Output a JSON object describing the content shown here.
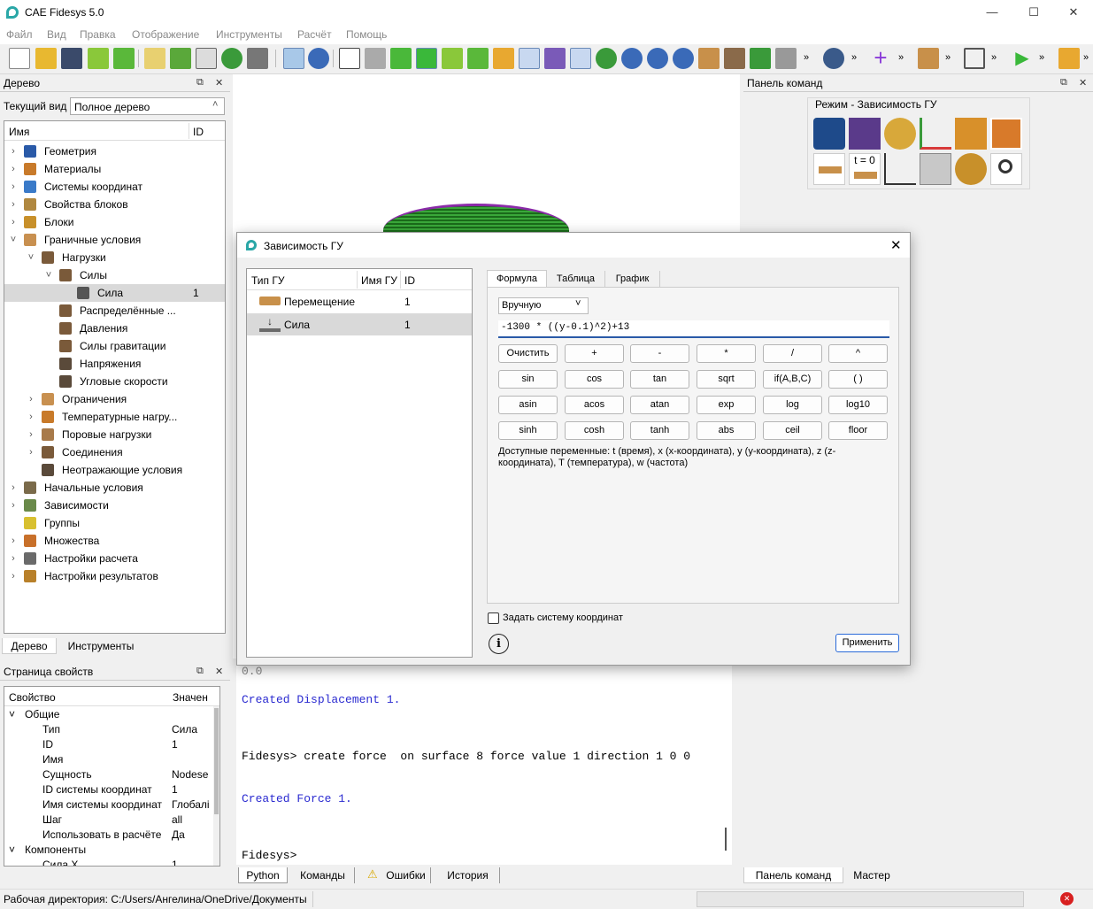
{
  "app": {
    "title": "CAE Fidesys 5.0"
  },
  "menu": [
    "Файл",
    "Вид",
    "Правка",
    "Отображение",
    "Инструменты",
    "Расчёт",
    "Помощь"
  ],
  "tree_panel": {
    "title": "Дерево",
    "view_label": "Текущий вид",
    "view_value": "Полное дерево",
    "col_name": "Имя",
    "col_id": "ID",
    "items": [
      {
        "label": "Геометрия",
        "level": 0,
        "arrow": "›",
        "id": "",
        "color": "#2a5aa8"
      },
      {
        "label": "Материалы",
        "level": 0,
        "arrow": "›",
        "id": "",
        "color": "#c87a2a"
      },
      {
        "label": "Системы координат",
        "level": 0,
        "arrow": "›",
        "id": "",
        "color": "#3a7ac8"
      },
      {
        "label": "Свойства блоков",
        "level": 0,
        "arrow": "›",
        "id": "",
        "color": "#b08840"
      },
      {
        "label": "Блоки",
        "level": 0,
        "arrow": "›",
        "id": "",
        "color": "#c8902a"
      },
      {
        "label": "Граничные условия",
        "level": 0,
        "arrow": "˅",
        "id": "",
        "color": "#c89050"
      },
      {
        "label": "Нагрузки",
        "level": 1,
        "arrow": "˅",
        "id": "",
        "color": "#7a5a3a"
      },
      {
        "label": "Силы",
        "level": 2,
        "arrow": "˅",
        "id": "",
        "color": "#7a5a3a"
      },
      {
        "label": "Сила",
        "level": 3,
        "arrow": "",
        "id": "1",
        "color": "#555555"
      },
      {
        "label": "Распределённые ...",
        "level": 2,
        "arrow": "",
        "id": "",
        "color": "#7a5a3a"
      },
      {
        "label": "Давления",
        "level": 2,
        "arrow": "",
        "id": "",
        "color": "#7a5a3a"
      },
      {
        "label": "Силы гравитации",
        "level": 2,
        "arrow": "",
        "id": "",
        "color": "#7a5a3a"
      },
      {
        "label": "Напряжения",
        "level": 2,
        "arrow": "",
        "id": "",
        "color": "#5a4a3a"
      },
      {
        "label": "Угловые скорости",
        "level": 2,
        "arrow": "",
        "id": "",
        "color": "#5a4a3a"
      },
      {
        "label": "Ограничения",
        "level": 1,
        "arrow": "›",
        "id": "",
        "color": "#c89050"
      },
      {
        "label": "Температурные нагру...",
        "level": 1,
        "arrow": "›",
        "id": "",
        "color": "#c87a2a"
      },
      {
        "label": "Поровые нагрузки",
        "level": 1,
        "arrow": "›",
        "id": "",
        "color": "#a87a4a"
      },
      {
        "label": "Соединения",
        "level": 1,
        "arrow": "›",
        "id": "",
        "color": "#7a5a3a"
      },
      {
        "label": "Неотражающие условия",
        "level": 1,
        "arrow": "",
        "id": "",
        "color": "#5a4a3a"
      },
      {
        "label": "Начальные условия",
        "level": 0,
        "arrow": "›",
        "id": "",
        "color": "#7a6a4a"
      },
      {
        "label": "Зависимости",
        "level": 0,
        "arrow": "›",
        "id": "",
        "color": "#6a8a4a"
      },
      {
        "label": "Группы",
        "level": 0,
        "arrow": "",
        "id": "",
        "color": "#d8c030"
      },
      {
        "label": "Множества",
        "level": 0,
        "arrow": "›",
        "id": "",
        "color": "#c8702a"
      },
      {
        "label": "Настройки расчета",
        "level": 0,
        "arrow": "›",
        "id": "",
        "color": "#6a6a6a"
      },
      {
        "label": "Настройки результатов",
        "level": 0,
        "arrow": "›",
        "id": "",
        "color": "#b8802a"
      }
    ],
    "tabs": [
      "Дерево",
      "Инструменты"
    ]
  },
  "props_panel": {
    "title": "Страница свойств",
    "col_prop": "Свойство",
    "col_val": "Значен",
    "rows": [
      {
        "name": "Общие",
        "value": "",
        "group": true
      },
      {
        "name": "Тип",
        "value": "Сила",
        "group": false
      },
      {
        "name": "ID",
        "value": "1",
        "group": false
      },
      {
        "name": "Имя",
        "value": "",
        "group": false
      },
      {
        "name": "Сущность",
        "value": "Nodese",
        "group": false
      },
      {
        "name": "ID системы координат",
        "value": "1",
        "group": false
      },
      {
        "name": "Имя системы координат",
        "value": "Глобалі",
        "group": false
      },
      {
        "name": "Шаг",
        "value": "all",
        "group": false
      },
      {
        "name": "Использовать в расчёте",
        "value": "Да",
        "group": false
      },
      {
        "name": "Компоненты",
        "value": "",
        "group": true
      },
      {
        "name": "Сила X",
        "value": "1",
        "group": false
      }
    ]
  },
  "console": {
    "lines": [
      {
        "text": "0.0",
        "style": "gray"
      },
      {
        "text": "Created Displacement 1.",
        "style": "blue"
      },
      {
        "text": "Fidesys> create force  on surface 8 force value 1 direction 1 0 0",
        "style": "prompt"
      },
      {
        "text": "Created Force 1.",
        "style": "blue"
      },
      {
        "text": "Fidesys>",
        "style": "prompt"
      }
    ],
    "tabs": [
      "Python",
      "Команды",
      "Ошибки",
      "История"
    ]
  },
  "command_panel": {
    "title": "Панель команд",
    "mode": "Режим - Зависимость ГУ",
    "icon_t0_label": "t = 0",
    "tabs": [
      "Панель команд",
      "Мастер"
    ]
  },
  "status": {
    "workdir": "Рабочая директория: C:/Users/Ангелина/OneDrive/Документы"
  },
  "dialog": {
    "title": "Зависимость ГУ",
    "list_headers": [
      "Тип ГУ",
      "Имя ГУ",
      "ID"
    ],
    "list_rows": [
      {
        "type": "Перемещение",
        "name": "",
        "id": "1"
      },
      {
        "type": "Сила",
        "name": "",
        "id": "1"
      }
    ],
    "tabs": [
      "Формула",
      "Таблица",
      "График"
    ],
    "mode_select": "Вручную",
    "formula": "-1300 * ((y-0.1)^2)+13",
    "buttons": [
      [
        "Очистить",
        "+",
        "-",
        "*",
        "/",
        "^"
      ],
      [
        "sin",
        "cos",
        "tan",
        "sqrt",
        "if(A,B,C)",
        "( )"
      ],
      [
        "asin",
        "acos",
        "atan",
        "exp",
        "log",
        "log10"
      ],
      [
        "sinh",
        "cosh",
        "tanh",
        "abs",
        "ceil",
        "floor"
      ]
    ],
    "vars_text": "Доступные переменные: t (время), x (x-координата), y (y-координата), z (z-координата), T (температура), w (частота)",
    "checkbox_label": "Задать систему координат",
    "apply_label": "Применить"
  }
}
